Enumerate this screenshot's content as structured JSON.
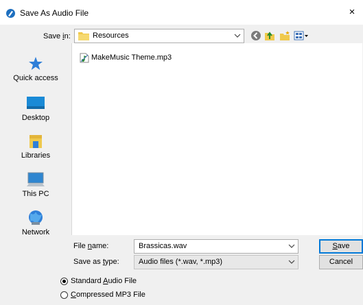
{
  "window": {
    "title": "Save As Audio File",
    "close_glyph": "×"
  },
  "toolbar": {
    "save_in_label_pre": "Save ",
    "save_in_label_key": "i",
    "save_in_label_post": "n:",
    "save_in_value": "Resources",
    "icons": [
      "back-icon",
      "up-folder-icon",
      "new-folder-icon",
      "view-menu-icon"
    ]
  },
  "places": [
    {
      "label": "Quick access",
      "icon": "star-icon"
    },
    {
      "label": "Desktop",
      "icon": "desktop-icon"
    },
    {
      "label": "Libraries",
      "icon": "libraries-icon"
    },
    {
      "label": "This PC",
      "icon": "computer-icon"
    },
    {
      "label": "Network",
      "icon": "network-icon"
    }
  ],
  "files": [
    {
      "name": "MakeMusic Theme.mp3",
      "icon": "audio-file-icon"
    }
  ],
  "form": {
    "filename_label_pre": "File ",
    "filename_label_key": "n",
    "filename_label_post": "ame:",
    "filename_value": "Brassicas.wav",
    "filetype_label_pre": "Save as ",
    "filetype_label_key": "t",
    "filetype_label_post": "ype:",
    "filetype_value": "Audio files (*.wav, *.mp3)"
  },
  "buttons": {
    "save_key": "S",
    "save_rest": "ave",
    "cancel": "Cancel"
  },
  "options": [
    {
      "pre": "Standard ",
      "key": "A",
      "post": "udio File",
      "checked": true
    },
    {
      "pre": "",
      "key": "C",
      "post": "ompressed MP3 File",
      "checked": false
    }
  ],
  "colors": {
    "accent": "#0078d7",
    "folder": "#f0c94c"
  }
}
